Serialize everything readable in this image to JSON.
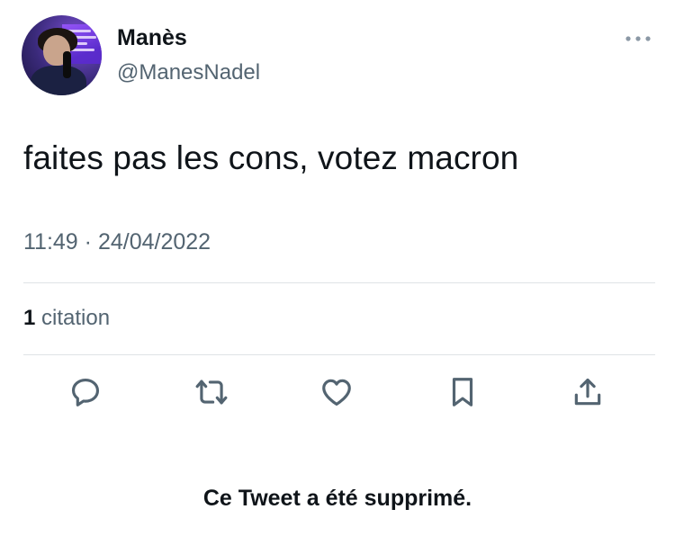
{
  "tweet": {
    "author_name": "Manès",
    "author_handle": "@ManesNadel",
    "text": "faites pas les cons, votez macron",
    "time": "11:49",
    "separator": "·",
    "date": "24/04/2022",
    "quote_count": "1",
    "quote_label": "citation"
  },
  "actions": [
    {
      "name": "reply",
      "icon": "speech-bubble-icon"
    },
    {
      "name": "retweet",
      "icon": "retweet-icon"
    },
    {
      "name": "like",
      "icon": "heart-icon"
    },
    {
      "name": "bookmark",
      "icon": "bookmark-icon"
    },
    {
      "name": "share",
      "icon": "share-icon"
    }
  ],
  "notice": "Ce Tweet a été supprimé.",
  "colors": {
    "text": "#0f1419",
    "secondary": "#536471",
    "divider": "#dfe3e6",
    "icon": "#536471",
    "avatar_bg": "#3a2a7a"
  }
}
